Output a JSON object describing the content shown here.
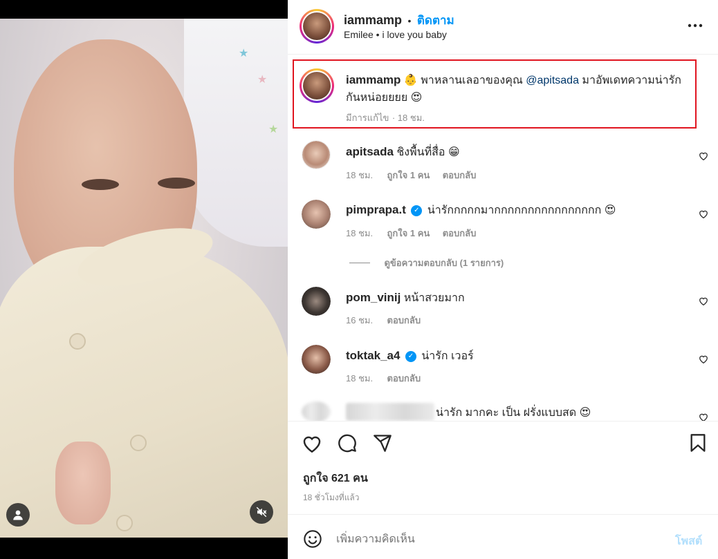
{
  "header": {
    "username": "iammamp",
    "dot": "•",
    "follow_label": "ติดตาม",
    "subtitle": "Emilee • i love you baby",
    "more_icon": "more-horizontal-icon"
  },
  "caption": {
    "username": "iammamp",
    "emoji": "👶",
    "text_before": "พาหลานเลอาของคุณ",
    "mention": "@apitsada",
    "text_after": "มาอัพเดทความน่ารักกันหน่อยยยย",
    "emoji_end": "😍",
    "edited_label": "มีการแก้ไข",
    "time": "· 18 ชม."
  },
  "comments": [
    {
      "username": "apitsada",
      "verified": false,
      "text": "ชิงพื้นที่สื่อ",
      "emoji": "😁",
      "time": "18 ชม.",
      "likes": "ถูกใจ 1 คน",
      "reply": "ตอบกลับ"
    },
    {
      "username": "pimprapa.t",
      "verified": true,
      "text": "น่ารักกกกกมากกกกกกกกกกกกกกกก",
      "emoji": "😍",
      "time": "18 ชม.",
      "likes": "ถูกใจ 1 คน",
      "reply": "ตอบกลับ"
    },
    {
      "username": "pom_vinij",
      "verified": false,
      "text": "หน้าสวยมาก",
      "emoji": "",
      "time": "16 ชม.",
      "likes": "",
      "reply": "ตอบกลับ"
    },
    {
      "username": "toktak_a4",
      "verified": true,
      "text": "น่ารัก เวอร์",
      "emoji": "",
      "time": "18 ชม.",
      "likes": "",
      "reply": "ตอบกลับ"
    }
  ],
  "view_replies": "ดูข้อความตอบกลับ (1 รายการ)",
  "partial_comment": {
    "text": "น่ารัก มากคะ เป็น ฝรั่งแบบสด",
    "emoji": "😍"
  },
  "actions": {
    "likes": "ถูกใจ 621 คน",
    "time_ago": "18 ชั่วโมงที่แล้ว"
  },
  "comment_box": {
    "placeholder": "เพิ่มความคิดเห็น",
    "post_label": "โพสต์"
  },
  "colors": {
    "accent": "#0095f6",
    "highlight_border": "#e0141f",
    "muted": "#8e8e8e"
  }
}
